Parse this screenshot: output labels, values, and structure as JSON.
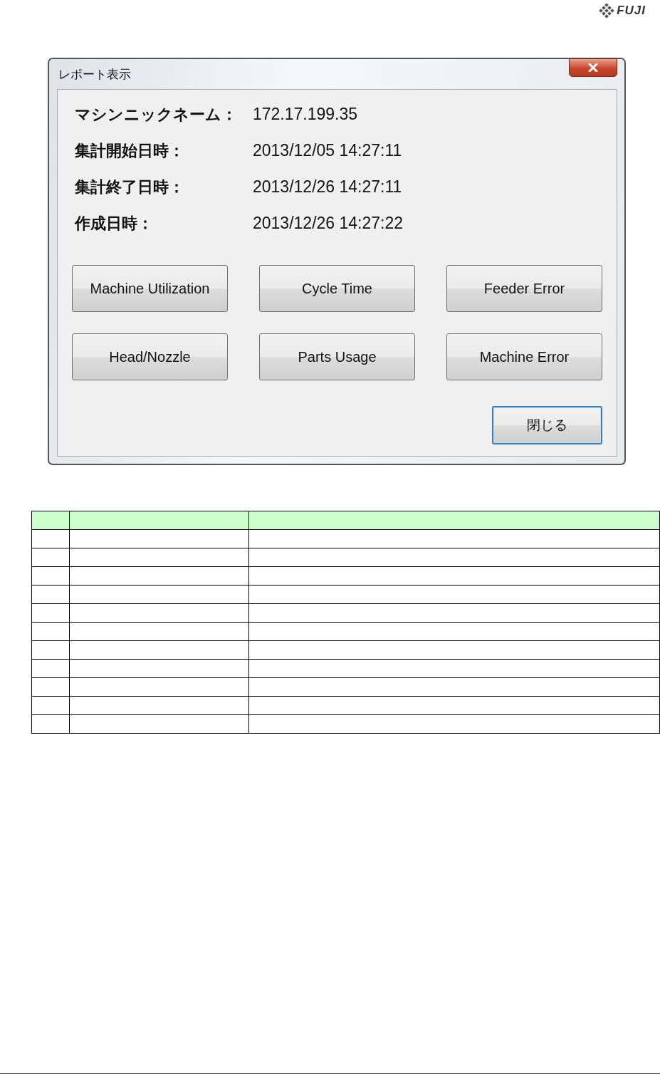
{
  "header": {
    "logo_text": "FUJI"
  },
  "window": {
    "title": "レポート表示"
  },
  "fields": [
    {
      "label": "マシンニックネーム：",
      "value": "172.17.199.35"
    },
    {
      "label": "集計開始日時：",
      "value": "2013/12/05 14:27:11"
    },
    {
      "label": "集計終了日時：",
      "value": "2013/12/26 14:27:11"
    },
    {
      "label": "作成日時：",
      "value": "2013/12/26 14:27:22"
    }
  ],
  "report_buttons": [
    "Machine Utilization",
    "Cycle Time",
    "Feeder Error",
    "Head/Nozzle",
    "Parts Usage",
    "Machine Error"
  ],
  "close_button": {
    "label": "閉じる",
    "focused": true
  }
}
